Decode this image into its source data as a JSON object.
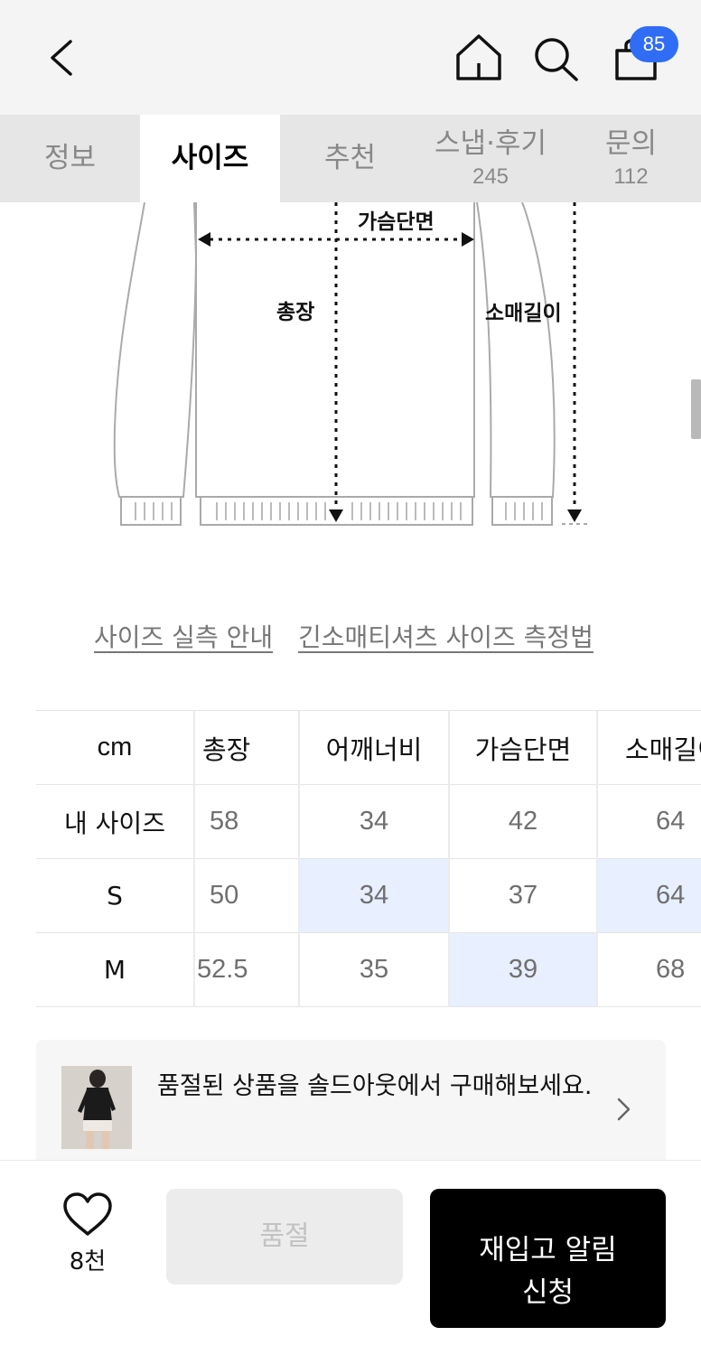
{
  "header": {
    "cart_count": "85"
  },
  "tabs": [
    {
      "label": "정보",
      "count": ""
    },
    {
      "label": "사이즈",
      "count": ""
    },
    {
      "label": "추천",
      "count": ""
    },
    {
      "label": "스냅·후기",
      "count": "245"
    },
    {
      "label": "문의",
      "count": "112"
    }
  ],
  "diagram": {
    "chest_label": "가슴단면",
    "length_label": "총장",
    "sleeve_label": "소매길이"
  },
  "links": {
    "size_guide": "사이즈 실측 안내",
    "measure_method": "긴소매티셔츠 사이즈 측정법"
  },
  "size_table": {
    "headers": [
      "cm",
      "총장",
      "어깨너비",
      "가슴단면",
      "소매길이"
    ],
    "rows": [
      {
        "label": "내 사이즈",
        "values": [
          "58",
          "34",
          "42",
          "64"
        ]
      },
      {
        "label": "S",
        "values": [
          "50",
          "34",
          "37",
          "64"
        ]
      },
      {
        "label": "M",
        "values": [
          "52.5",
          "35",
          "39",
          "68"
        ]
      }
    ]
  },
  "banner": {
    "text": "품절된 상품을 솔드아웃에서 구매해보세요."
  },
  "bottom": {
    "like_count": "8천",
    "soldout_label": "품절",
    "restock_line1": "재입고 알림",
    "restock_line2": "신청"
  },
  "colors": {
    "badge": "#2f6df6",
    "highlight": "#e8efff",
    "primary_button": "#000000"
  }
}
